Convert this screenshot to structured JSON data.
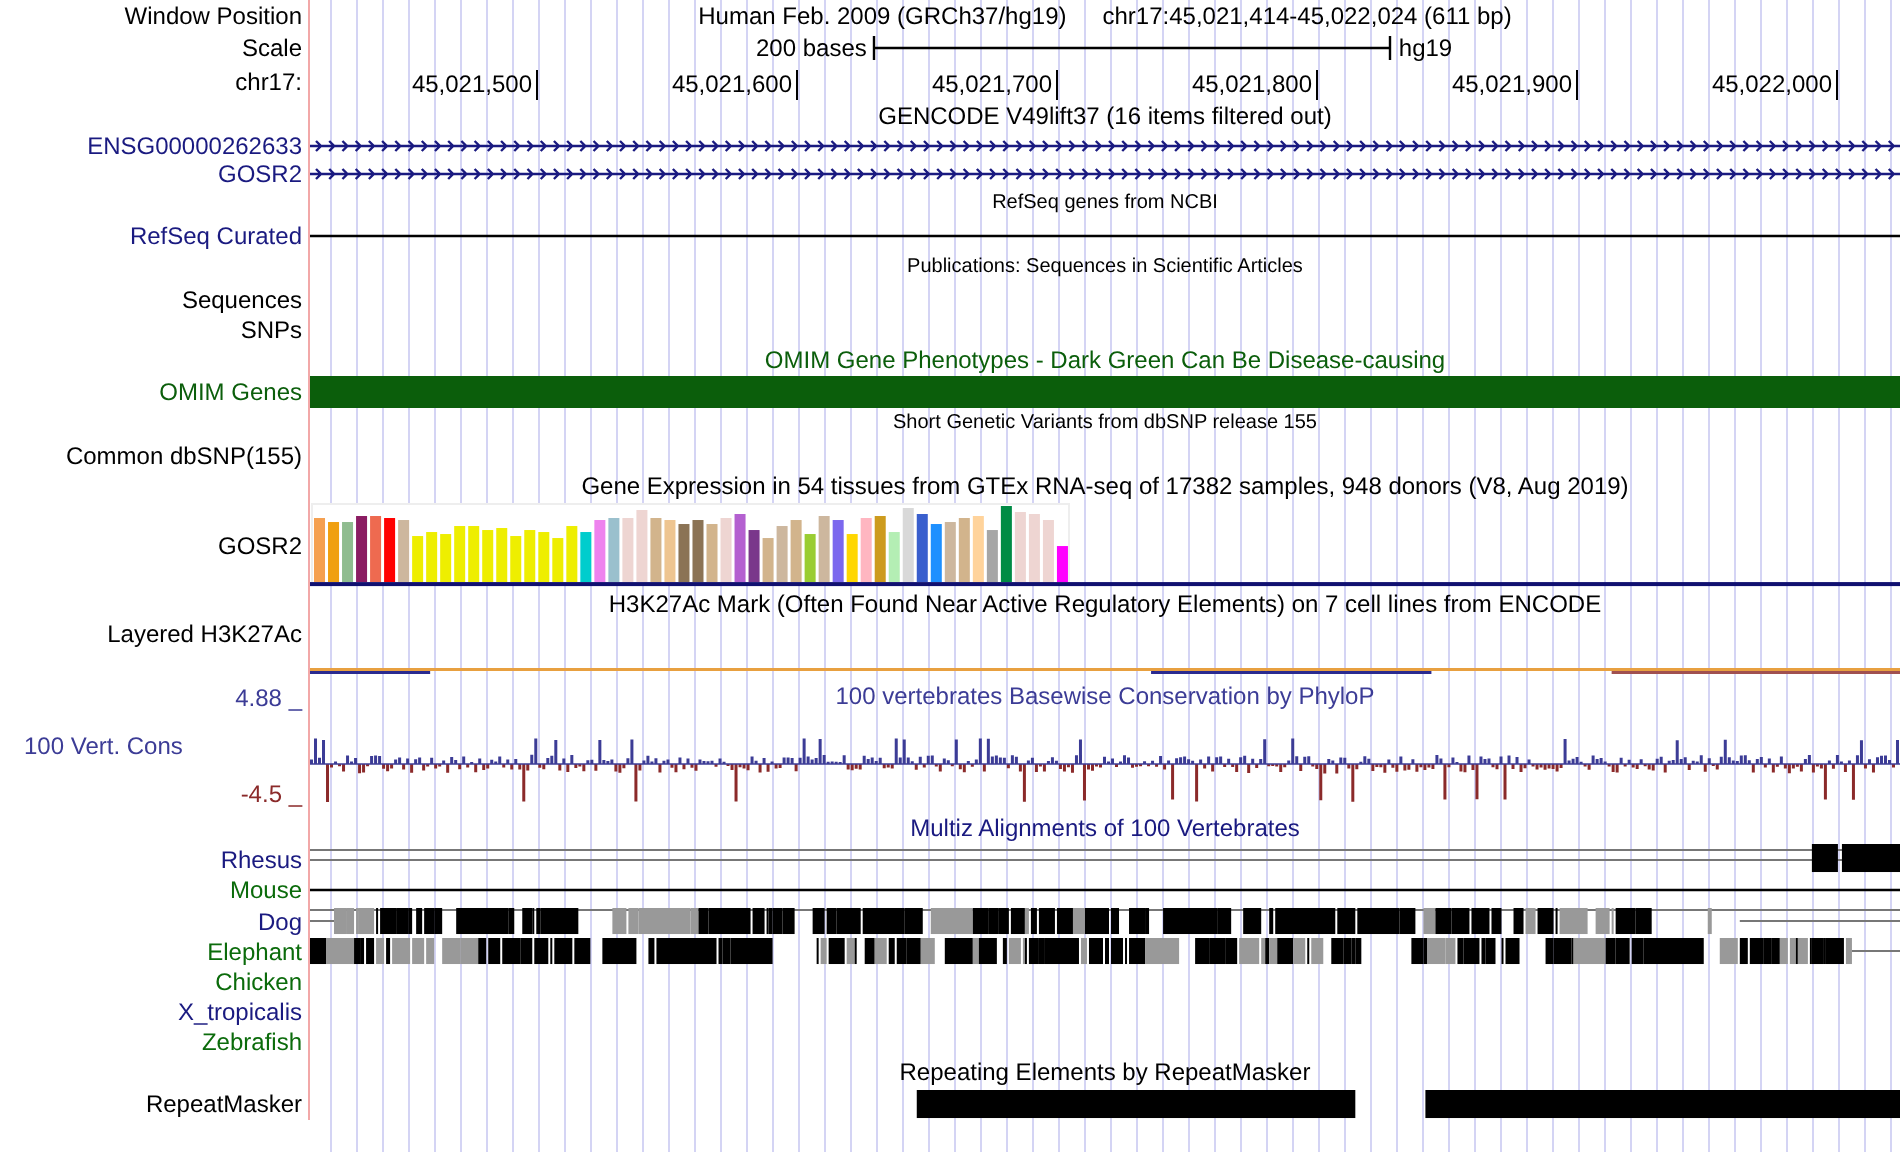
{
  "header": {
    "window_position_label": "Window Position",
    "assembly_title": "Human Feb. 2009 (GRCh37/hg19)",
    "position": "chr17:45,021,414-45,022,024 (611 bp)",
    "scale_label": "Scale",
    "scale_text": "200 bases",
    "assembly": "hg19",
    "chrom_label": "chr17:",
    "ticks": [
      "45,021,500",
      "45,021,600",
      "45,021,700",
      "45,021,800",
      "45,021,900",
      "45,022,000"
    ]
  },
  "tracks": [
    {
      "kind": "gene",
      "title": "GENCODE V49lift37 (16 items filtered out)",
      "color": "#000000",
      "small": false,
      "rows": [
        {
          "label": "ENSG00000262633",
          "color": "#1a1a80",
          "kind": "gene"
        },
        {
          "label": "GOSR2",
          "color": "#1a1a80",
          "kind": "gene"
        }
      ]
    },
    {
      "kind": "line",
      "title": "RefSeq genes from NCBI",
      "color": "#000000",
      "small": true,
      "rows": [
        {
          "label": "RefSeq Curated",
          "color": "#1a1a80",
          "kind": "line"
        }
      ]
    },
    {
      "kind": "empty",
      "title": "Publications: Sequences in Scientific Articles",
      "color": "#000000",
      "small": true,
      "rows": [
        {
          "label": "Sequences",
          "color": "#000000",
          "kind": "none"
        },
        {
          "label": "SNPs",
          "color": "#000000",
          "kind": "none"
        }
      ]
    },
    {
      "kind": "bar",
      "title": "OMIM Gene Phenotypes - Dark Green Can Be Disease-causing",
      "color": "#0b5e0b",
      "small": false,
      "rows": [
        {
          "label": "OMIM Genes",
          "color": "#0b5e0b",
          "kind": "bar"
        }
      ]
    },
    {
      "kind": "empty",
      "title": "Short Genetic Variants from dbSNP release 155",
      "color": "#000000",
      "small": true,
      "rows": [
        {
          "label": "Common dbSNP(155)",
          "color": "#000000",
          "kind": "none"
        }
      ]
    },
    {
      "kind": "expression",
      "title": "Gene Expression in 54 tissues from GTEx RNA-seq of 17382 samples, 948 donors (V8, Aug 2019)",
      "color": "#000000",
      "small": false,
      "rows": [
        {
          "label": "GOSR2",
          "color": "#000000",
          "kind": "expression"
        }
      ]
    },
    {
      "kind": "layered",
      "title": "H3K27Ac Mark (Often Found Near Active Regulatory Elements) on 7 cell lines from ENCODE",
      "color": "#000000",
      "small": false,
      "rows": [
        {
          "label": "Layered H3K27Ac",
          "color": "#000000",
          "kind": "layered"
        }
      ]
    },
    {
      "kind": "wiggle",
      "title": "100 vertebrates Basewise Conservation by PhyloP",
      "color": "#3c3c96",
      "label": "100 Vert. Cons",
      "max": {
        "text": "4.88 _",
        "color": "#3c3c96"
      },
      "min": {
        "text": "-4.5 _",
        "color": "#8b2a2a"
      }
    },
    {
      "kind": "alignment",
      "title": "Multiz Alignments of 100 Vertebrates",
      "color": "#1a1a80",
      "small": false,
      "rows": [
        {
          "label": "Rhesus",
          "color": "#1a1a80",
          "kind": "sparse"
        },
        {
          "label": "Mouse",
          "color": "#0b6b0b",
          "kind": "line"
        },
        {
          "label": "Dog",
          "color": "#1a1a80",
          "kind": "blocks"
        },
        {
          "label": "Elephant",
          "color": "#0b6b0b",
          "kind": "dense"
        },
        {
          "label": "Chicken",
          "color": "#0b6b0b",
          "kind": "none"
        },
        {
          "label": "X_tropicalis",
          "color": "#1a1a80",
          "kind": "none"
        },
        {
          "label": "Zebrafish",
          "color": "#0b6b0b",
          "kind": "none"
        }
      ]
    },
    {
      "kind": "repeat",
      "title": "Repeating Elements by RepeatMasker",
      "color": "#000000",
      "small": false,
      "rows": [
        {
          "label": "RepeatMasker",
          "color": "#000000",
          "kind": "repeat"
        }
      ]
    }
  ]
}
